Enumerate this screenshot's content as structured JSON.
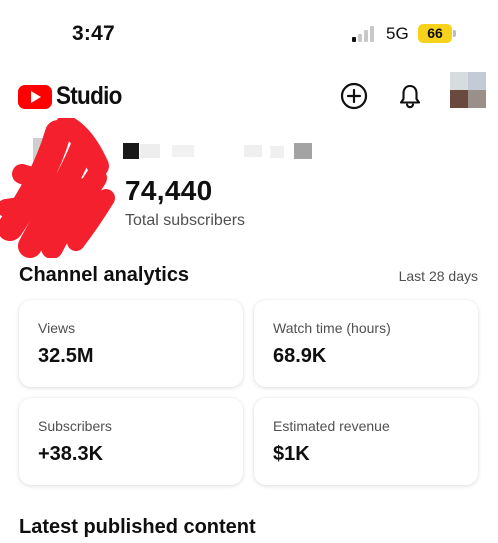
{
  "status_bar": {
    "time": "3:47",
    "network": "5G",
    "battery": "66",
    "signal_bars_active": 1
  },
  "app_bar": {
    "logo_text": "Studio",
    "add_icon": "plus-circle-icon",
    "notifications_icon": "bell-icon",
    "brand_color": "#ff0000"
  },
  "channel": {
    "subscriber_count": "74,440",
    "subscriber_label": "Total subscribers"
  },
  "analytics": {
    "title": "Channel analytics",
    "range": "Last 28 days",
    "metrics": [
      {
        "label": "Views",
        "value": "32.5M"
      },
      {
        "label": "Watch time (hours)",
        "value": "68.9K"
      },
      {
        "label": "Subscribers",
        "value": "+38.3K"
      },
      {
        "label": "Estimated revenue",
        "value": "$1K"
      }
    ]
  },
  "latest": {
    "title": "Latest published content"
  }
}
